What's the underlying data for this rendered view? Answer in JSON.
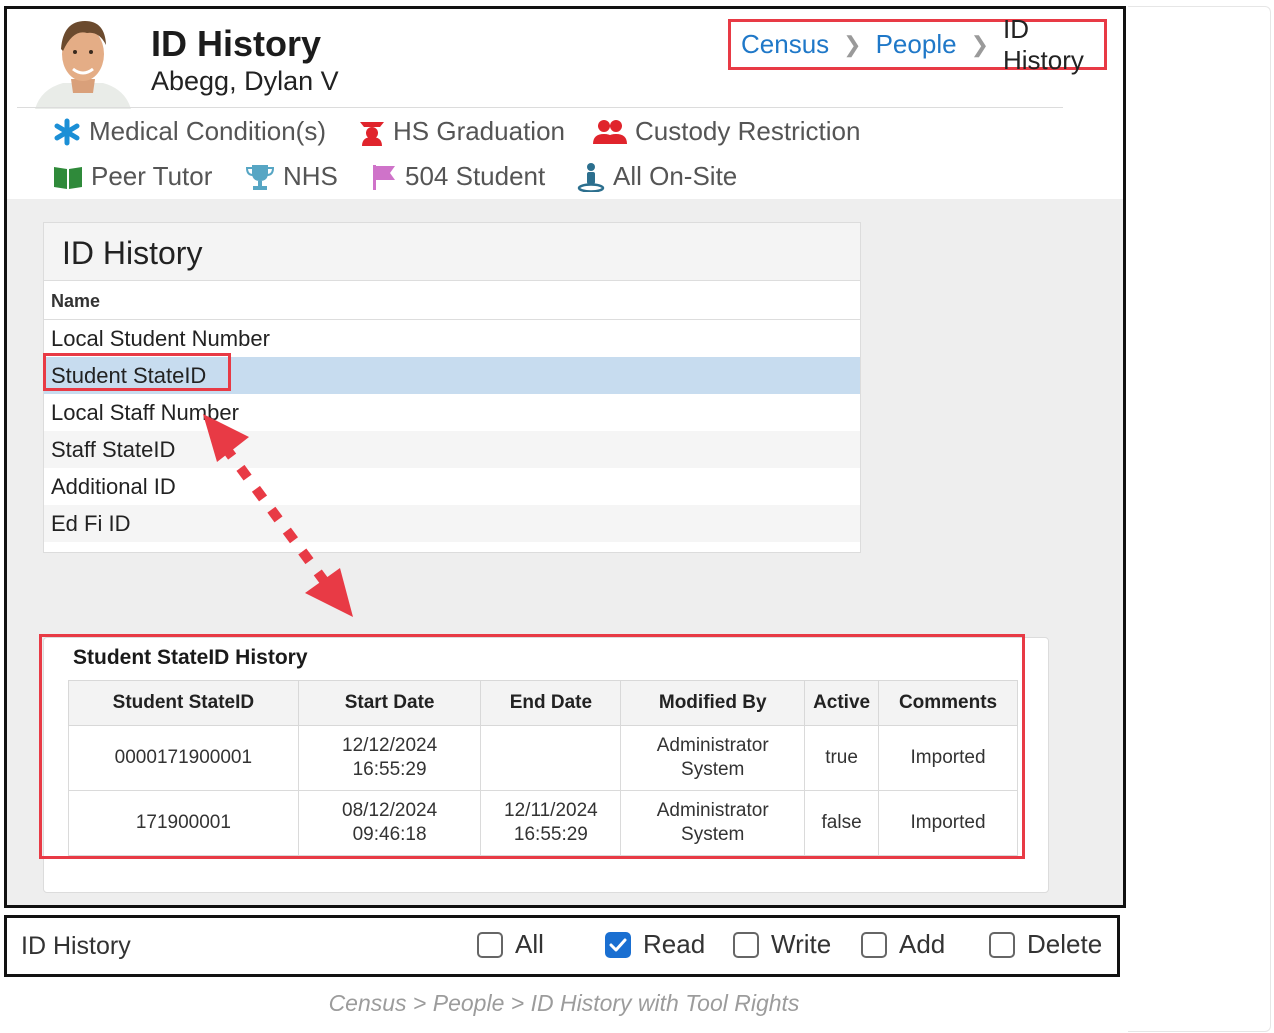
{
  "header": {
    "title": "ID History",
    "student_name": "Abegg, Dylan V"
  },
  "breadcrumb": {
    "census": "Census",
    "people": "People",
    "current": "ID History",
    "sep": ">"
  },
  "flags": {
    "medical": "Medical Condition(s)",
    "hs_grad": "HS Graduation",
    "custody": "Custody Restriction",
    "peer_tutor": "Peer Tutor",
    "nhs": "NHS",
    "s504": "504 Student",
    "onsite": "All On-Site"
  },
  "id_panel": {
    "title": "ID History",
    "column": "Name",
    "rows": [
      "Local Student Number",
      "Student StateID",
      "Local Staff Number",
      "Staff StateID",
      "Additional ID",
      "Ed Fi ID"
    ]
  },
  "history": {
    "title": "Student StateID History",
    "headers": [
      "Student StateID",
      "Start Date",
      "End Date",
      "Modified By",
      "Active",
      "Comments"
    ],
    "rows": [
      {
        "id": "0000171900001",
        "start_date": "12/12/2024",
        "start_time": "16:55:29",
        "end_date": "",
        "end_time": "",
        "mod1": "Administrator",
        "mod2": "System",
        "active": "true",
        "comments": "Imported"
      },
      {
        "id": "171900001",
        "start_date": "08/12/2024",
        "start_time": "09:46:18",
        "end_date": "12/11/2024",
        "end_time": "16:55:29",
        "mod1": "Administrator",
        "mod2": "System",
        "active": "false",
        "comments": "Imported"
      }
    ]
  },
  "tool_rights": {
    "label": "ID History",
    "all": "All",
    "read": "Read",
    "write": "Write",
    "add": "Add",
    "delete": "Delete",
    "read_checked": true
  },
  "caption": "Census > People > ID History with Tool Rights",
  "colors": {
    "accent": "#1f78c8",
    "highlight": "#e83a45",
    "selected_row": "#c7dcef",
    "checkbox": "#1a6fd1"
  }
}
